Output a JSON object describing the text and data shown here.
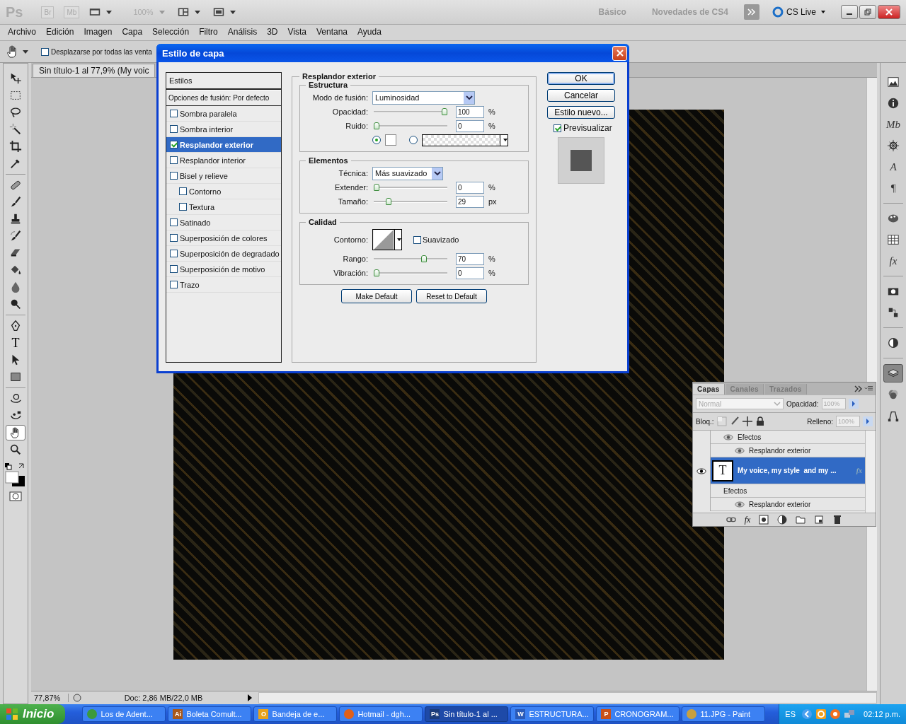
{
  "app_bar": {
    "logo": "Ps",
    "bridge": "Br",
    "mini_bridge": "Mb",
    "zoom": "100%",
    "workspaces": [
      "Básico",
      "Novedades de CS4"
    ],
    "cs_live": "CS Live"
  },
  "menu": [
    "Archivo",
    "Edición",
    "Imagen",
    "Capa",
    "Selección",
    "Filtro",
    "Análisis",
    "3D",
    "Vista",
    "Ventana",
    "Ayuda"
  ],
  "options_bar": {
    "option": {
      "label": "Desplazarse por todas las venta",
      "checked": false
    }
  },
  "document_tab": {
    "title": "Sin título-1 al 77,9% (My voic"
  },
  "tools": [
    {
      "kind": "move",
      "selected": false
    },
    {
      "kind": "marquee",
      "selected": false
    },
    {
      "kind": "lasso",
      "selected": false
    },
    {
      "kind": "wand",
      "selected": false
    },
    {
      "kind": "crop",
      "selected": false
    },
    {
      "kind": "eyedropper",
      "selected": false
    },
    {
      "kind": "bandage",
      "selected": false
    },
    {
      "kind": "brush",
      "selected": false
    },
    {
      "kind": "stamp",
      "selected": false
    },
    {
      "kind": "history",
      "selected": false
    },
    {
      "kind": "eraser",
      "selected": false
    },
    {
      "kind": "bucket",
      "selected": false
    },
    {
      "kind": "drop",
      "selected": false
    },
    {
      "kind": "dodge",
      "selected": false
    },
    {
      "kind": "pen",
      "selected": false
    },
    {
      "kind": "type",
      "glyph": "T",
      "selected": false
    },
    {
      "kind": "arrow",
      "selected": false
    },
    {
      "kind": "shape",
      "selected": false
    },
    {
      "kind": "rotate",
      "selected": false
    },
    {
      "kind": "orbit",
      "selected": false
    },
    {
      "kind": "hand",
      "selected": true
    },
    {
      "kind": "zoom",
      "selected": false
    }
  ],
  "panel_icons": [
    {
      "kind": "picture",
      "selected": false
    },
    {
      "kind": "info",
      "selected": false
    },
    {
      "kind": "glyph",
      "glyph": "Mb",
      "selected": false
    },
    {
      "kind": "wheel",
      "selected": false
    },
    {
      "kind": "glyph",
      "glyph": "A",
      "selected": false
    },
    {
      "kind": "glyph",
      "glyph": "¶",
      "selected": false
    },
    {
      "kind": "palette",
      "selected": false
    },
    {
      "kind": "grid",
      "selected": false
    },
    {
      "kind": "glyph",
      "glyph": "fx",
      "selected": false
    },
    {
      "kind": "camera",
      "selected": false
    },
    {
      "kind": "clone",
      "selected": false
    },
    {
      "kind": "circle",
      "selected": false
    },
    {
      "kind": "layers",
      "selected": true
    },
    {
      "kind": "channels",
      "selected": false
    },
    {
      "kind": "paths",
      "selected": false
    }
  ],
  "status_bar": {
    "zoom": "77,87%",
    "doc_size": "Doc: 2,86 MB/22,0 MB"
  },
  "dialog": {
    "title": "Estilo de capa",
    "styles_header": "Estilos",
    "blend_options": "Opciones de fusión: Por defecto",
    "styles": [
      {
        "label": "Sombra paralela",
        "checked": false,
        "selected": false
      },
      {
        "label": "Sombra interior",
        "checked": false,
        "selected": false
      },
      {
        "label": "Resplandor exterior",
        "checked": true,
        "selected": true
      },
      {
        "label": "Resplandor interior",
        "checked": false,
        "selected": false
      },
      {
        "label": "Bisel y relieve",
        "checked": false,
        "selected": false,
        "children": [
          {
            "label": "Contorno",
            "checked": false,
            "selected": false
          },
          {
            "label": "Textura",
            "checked": false,
            "selected": false
          }
        ]
      },
      {
        "label": "Satinado",
        "checked": false,
        "selected": false
      },
      {
        "label": "Superposición de colores",
        "checked": false,
        "selected": false
      },
      {
        "label": "Superposición de degradado",
        "checked": false,
        "selected": false
      },
      {
        "label": "Superposición de motivo",
        "checked": false,
        "selected": false
      },
      {
        "label": "Trazo",
        "checked": false,
        "selected": false
      }
    ],
    "section_title": "Resplandor exterior",
    "groups": [
      {
        "title": "Estructura",
        "rows": [
          {
            "kind": "select",
            "label": "Modo de fusión:",
            "value": "Luminosidad"
          },
          {
            "kind": "slider",
            "label": "Opacidad:",
            "level": 1,
            "value": "100",
            "unit": "%"
          },
          {
            "kind": "slider",
            "label": "Ruido:",
            "level": 0,
            "value": "0",
            "unit": "%"
          },
          {
            "kind": "source",
            "options": [
              {
                "kind": "color",
                "selected": true
              },
              {
                "kind": "gradient",
                "selected": false
              }
            ]
          }
        ]
      },
      {
        "title": "Elementos",
        "rows": [
          {
            "kind": "select",
            "label": "Técnica:",
            "value": "Más suavizado"
          },
          {
            "kind": "slider",
            "label": "Extender:",
            "level": 0,
            "value": "0",
            "unit": "%"
          },
          {
            "kind": "slider",
            "label": "Tamaño:",
            "level": 0.18,
            "value": "29",
            "unit": "px"
          }
        ]
      },
      {
        "title": "Calidad",
        "rows": [
          {
            "kind": "contour",
            "label": "Contorno:",
            "option": {
              "label": "Suavizado",
              "checked": false
            }
          },
          {
            "kind": "slider",
            "label": "Rango:",
            "level": 0.7,
            "value": "70",
            "unit": "%"
          },
          {
            "kind": "slider",
            "label": "Vibración:",
            "level": 0,
            "value": "0",
            "unit": "%"
          }
        ]
      }
    ],
    "footer_buttons": [
      "Make Default",
      "Reset to Default"
    ],
    "buttons": [
      {
        "label": "OK",
        "default": true
      },
      {
        "label": "Cancelar",
        "default": false
      },
      {
        "label": "Estilo nuevo...",
        "default": false
      }
    ],
    "preview": {
      "label": "Previsualizar",
      "checked": true
    }
  },
  "layers_panel": {
    "tabs": [
      {
        "label": "Capas",
        "selected": true
      },
      {
        "label": "Canales",
        "selected": false
      },
      {
        "label": "Trazados",
        "selected": false
      }
    ],
    "blend_mode": {
      "value": "Normal",
      "disabled": true
    },
    "opacity": {
      "label": "Opacidad:",
      "value": "100%"
    },
    "lock": {
      "label": "Bloq.:"
    },
    "fill": {
      "label": "Relleno:",
      "value": "100%"
    },
    "rows": [
      {
        "kind": "effects",
        "label": "Efectos",
        "visible": true,
        "selected": false
      },
      {
        "kind": "effect",
        "label": "Resplandor exterior",
        "visible": true,
        "selected": false
      },
      {
        "kind": "layer",
        "label": "My voice, my style  and my ...",
        "thumb": "T",
        "badge": "fx",
        "visible": true,
        "selected": true
      },
      {
        "kind": "effects",
        "label": "Efectos",
        "visible": false,
        "selected": false
      },
      {
        "kind": "effect",
        "label": "Resplandor exterior",
        "visible": true,
        "selected": false
      }
    ],
    "footer_fx": "fx"
  },
  "taskbar": {
    "start": "Inicio",
    "tasks": [
      {
        "label": "Los de Adent...",
        "color": "#3c9a3c",
        "selected": false
      },
      {
        "label": "Boleta Comult...",
        "badge": "Ai",
        "color": "#a8581a",
        "selected": false
      },
      {
        "label": "Bandeja de e...",
        "badge": "O",
        "color": "#e8a21a",
        "selected": false
      },
      {
        "label": "Hotmail - dgh...",
        "color": "#e0601a",
        "selected": false
      },
      {
        "label": "Sin título-1 al ...",
        "badge": "Ps",
        "color": "#1a3c7a",
        "selected": true
      },
      {
        "label": "ESTRUCTURA...",
        "badge": "W",
        "color": "#2a5ab8",
        "selected": false
      },
      {
        "label": "CRONOGRAM...",
        "badge": "P",
        "color": "#c8501a",
        "selected": false
      },
      {
        "label": "11.JPG - Paint",
        "color": "#c8a040",
        "selected": false
      }
    ],
    "language": "ES",
    "clock": "02:12 p.m."
  }
}
